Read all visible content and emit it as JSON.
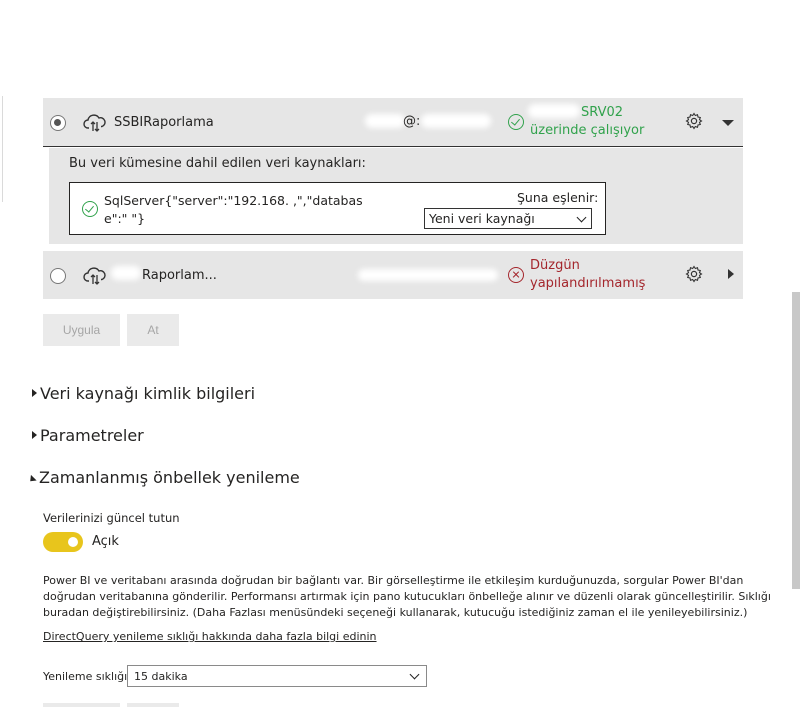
{
  "gateways": [
    {
      "name": "SSBIRaporlama",
      "email_suffix": "@:",
      "status_line1": "SRV02",
      "status_line2": "üzerinde çalışıyor",
      "status_color": "#31a24c",
      "selected": true,
      "expanded": true
    },
    {
      "name": "Raporlam...",
      "email_suffix": "",
      "status_line1": "Düzgün",
      "status_line2": "yapılandırılmamış",
      "status_color": "#a4262c",
      "selected": false,
      "expanded": false
    }
  ],
  "datasource_panel": {
    "title": "Bu veri kümesine dahil edilen veri kaynakları:",
    "source_text": "SqlServer{\"server\":\"192.168. ,\",\"database\":\" \"}",
    "map_label": "Şuna eşlenir:",
    "map_value": "Yeni veri kaynağı"
  },
  "buttons": {
    "apply": "Uygula",
    "discard": "At"
  },
  "sections": {
    "credentials": "Veri kaynağı kimlik bilgileri",
    "parameters": "Parametreler",
    "cache_refresh": "Zamanlanmış önbellek yenileme"
  },
  "keep_updated": {
    "label": "Verilerinizi güncel tutun",
    "toggle_state": "Açık",
    "toggle_color": "#e8c51c"
  },
  "description": "Power BI ve veritabanı arasında doğrudan bir bağlantı var. Bir görselleştirme ile etkileşim kurduğunuzda, sorgular Power BI'dan doğrudan veritabanına gönderilir. Performansı artırmak için pano kutucukları önbelleğe alınır ve düzenli olarak güncelleştirilir. Sıklığı buradan değiştirebilirsiniz. (Daha Fazlası menüsündeki seçeneği kullanarak, kutucuğu istediğiniz zaman el ile yenileyebilirsiniz.)",
  "learn_more_link": "DirectQuery yenileme sıklığı hakkında daha fazla bilgi edinin",
  "refresh_frequency": {
    "label": "Yenileme sıklığı",
    "value": "15 dakika"
  }
}
